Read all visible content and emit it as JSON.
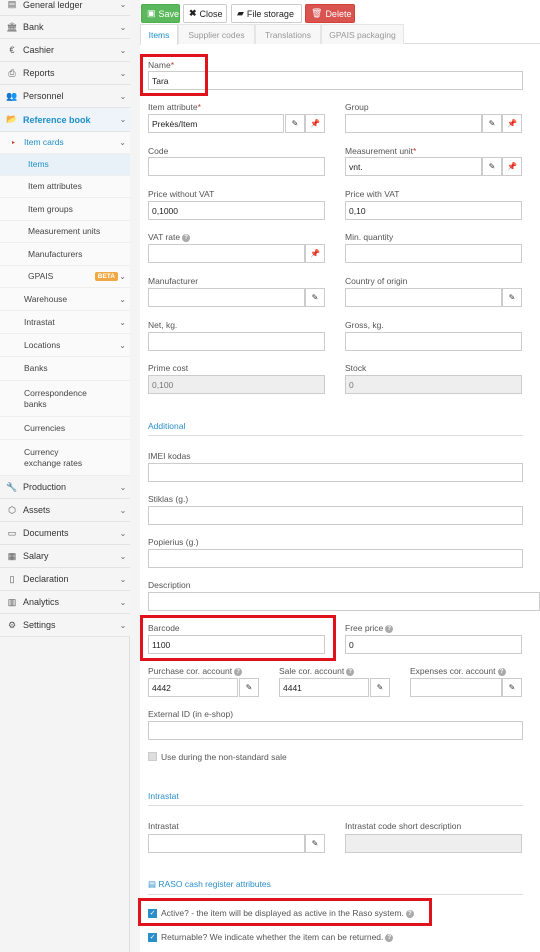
{
  "sidebar": {
    "items": [
      {
        "label": "General ledger",
        "icon": "ledger-icon"
      },
      {
        "label": "Bank",
        "icon": "bank-icon"
      },
      {
        "label": "Cashier",
        "icon": "euro-icon"
      },
      {
        "label": "Reports",
        "icon": "print-icon"
      },
      {
        "label": "Personnel",
        "icon": "people-icon"
      },
      {
        "label": "Reference book",
        "icon": "folder-icon"
      }
    ],
    "item_cards_label": "Item cards",
    "item_cards_sub": [
      "Items",
      "Item attributes",
      "Item groups",
      "Measurement units",
      "Manufacturers",
      "GPAIS"
    ],
    "beta_label": "BETA",
    "ref_sub": [
      "Warehouse",
      "Intrastat",
      "Locations",
      "Banks",
      "Correspondence banks",
      "Currencies",
      "Currency exchange rates"
    ],
    "bottom_items": [
      {
        "label": "Production",
        "icon": "wrench-icon"
      },
      {
        "label": "Assets",
        "icon": "box-icon"
      },
      {
        "label": "Documents",
        "icon": "inbox-icon"
      },
      {
        "label": "Salary",
        "icon": "table-icon"
      },
      {
        "label": "Declaration",
        "icon": "document-icon"
      },
      {
        "label": "Analytics",
        "icon": "bar-chart-icon"
      },
      {
        "label": "Settings",
        "icon": "gears-icon"
      }
    ]
  },
  "toolbar": {
    "save": "Save",
    "close": "Close",
    "file_storage": "File storage",
    "delete": "Delete"
  },
  "tabs": [
    "Items",
    "Supplier codes",
    "Translations",
    "GPAIS packaging"
  ],
  "form": {
    "name_label": "Name",
    "name_value": "Tara",
    "item_attribute_label": "Item attribute",
    "item_attribute_value": "Prekės/Item",
    "group_label": "Group",
    "group_value": "",
    "code_label": "Code",
    "code_value": "",
    "measurement_unit_label": "Measurement unit",
    "measurement_unit_value": "vnt.",
    "price_without_vat_label": "Price without VAT",
    "price_without_vat_value": "0,1000",
    "price_with_vat_label": "Price with VAT",
    "price_with_vat_value": "0,10",
    "vat_rate_label": "VAT rate",
    "vat_rate_value": "",
    "min_quantity_label": "Min. quantity",
    "min_quantity_value": "",
    "manufacturer_label": "Manufacturer",
    "manufacturer_value": "",
    "country_of_origin_label": "Country of origin",
    "country_of_origin_value": "",
    "net_kg_label": "Net, kg.",
    "net_kg_value": "",
    "gross_kg_label": "Gross, kg.",
    "gross_kg_value": "",
    "prime_cost_label": "Prime cost",
    "prime_cost_value": "0,100",
    "stock_label": "Stock",
    "stock_value": "0",
    "additional_section": "Additional",
    "imei_label": "IMEI kodas",
    "imei_value": "",
    "stiklas_label": "Stiklas (g.)",
    "stiklas_value": "",
    "popierius_label": "Popierius (g.)",
    "popierius_value": "",
    "description_label": "Description",
    "description_value": "",
    "barcode_label": "Barcode",
    "barcode_value": "1100",
    "free_price_label": "Free price",
    "free_price_value": "0",
    "purchase_cor_label": "Purchase cor. account",
    "purchase_cor_value": "4442",
    "sale_cor_label": "Sale cor. account",
    "sale_cor_value": "4441",
    "expenses_cor_label": "Expenses cor. account",
    "expenses_cor_value": "",
    "external_id_label": "External ID (in e-shop)",
    "external_id_value": "",
    "non_standard_label": "Use during the non-standard sale",
    "intrastat_section": "Intrastat",
    "intrastat_label": "Intrastat",
    "intrastat_value": "",
    "intrastat_desc_label": "Intrastat code short description",
    "intrastat_desc_value": "",
    "raso_section": "RASO cash register attributes",
    "active_label": "Active? - the item will be displayed as active in the Raso system.",
    "returnable_label": "Returnable? We indicate whether the item can be returned."
  },
  "colors": {
    "accent": "#1d8fc9",
    "save": "#5cb85c",
    "delete": "#d9534f",
    "highlight": "#e0121c"
  }
}
